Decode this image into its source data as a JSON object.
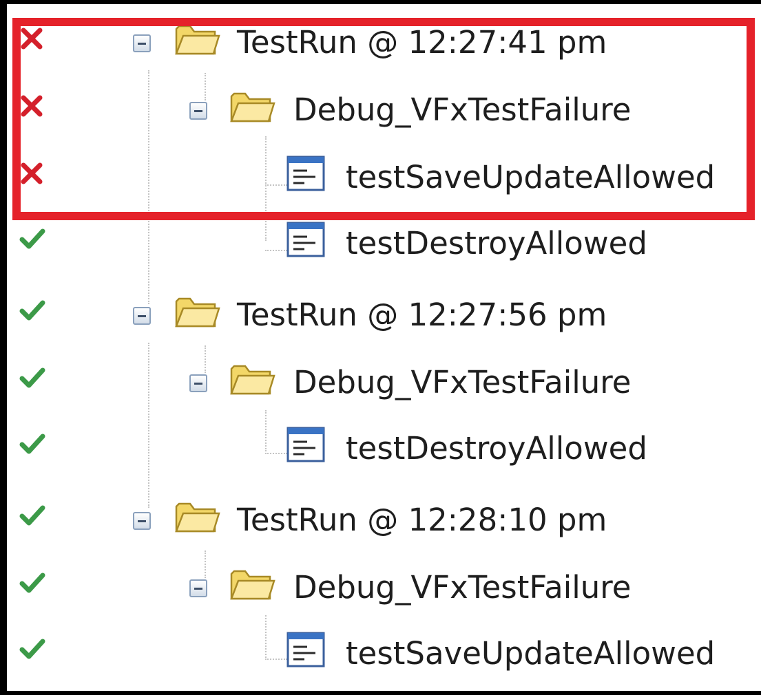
{
  "tree": {
    "rows": [
      {
        "label": "TestRun @ 12:27:41 pm",
        "status": "fail",
        "kind": "folder",
        "depth": 0
      },
      {
        "label": "Debug_VFxTestFailure",
        "status": "fail",
        "kind": "folder",
        "depth": 1
      },
      {
        "label": "testSaveUpdateAllowed",
        "status": "fail",
        "kind": "test",
        "depth": 2
      },
      {
        "label": "testDestroyAllowed",
        "status": "pass",
        "kind": "test",
        "depth": 2
      },
      {
        "label": "TestRun @ 12:27:56 pm",
        "status": "pass",
        "kind": "folder",
        "depth": 0
      },
      {
        "label": "Debug_VFxTestFailure",
        "status": "pass",
        "kind": "folder",
        "depth": 1
      },
      {
        "label": "testDestroyAllowed",
        "status": "pass",
        "kind": "test",
        "depth": 2
      },
      {
        "label": "TestRun @ 12:28:10 pm",
        "status": "pass",
        "kind": "folder",
        "depth": 0
      },
      {
        "label": "Debug_VFxTestFailure",
        "status": "pass",
        "kind": "folder",
        "depth": 1
      },
      {
        "label": "testSaveUpdateAllowed",
        "status": "pass",
        "kind": "test",
        "depth": 2
      }
    ]
  },
  "icons": {
    "fail": "red-x-icon",
    "pass": "green-check-icon",
    "folder": "open-folder-icon",
    "test": "test-method-icon",
    "toggle": "collapse-minus-icon"
  },
  "colors": {
    "fail": "#d4202b",
    "pass": "#3c9a48",
    "highlight": "#e5222a",
    "folder": "#f3d768"
  }
}
